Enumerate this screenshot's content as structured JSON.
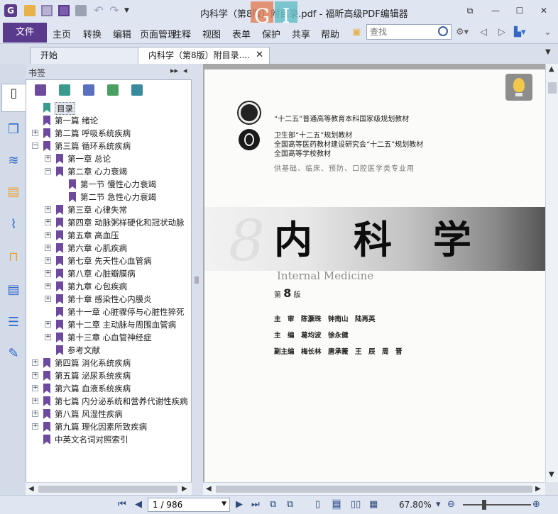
{
  "window": {
    "title": "内科学（第8版）附目录.pdf - 福昕高级PDF编辑器",
    "logo_letters": [
      "G",
      "I"
    ],
    "minimize": "—",
    "maximize": "☐",
    "close": "✕"
  },
  "ribbon": {
    "file": "文件",
    "menus": [
      "主页",
      "转换",
      "编辑",
      "页面管理",
      "注释",
      "视图",
      "表单",
      "保护",
      "共享",
      "帮助"
    ],
    "search_placeholder": "查找"
  },
  "tabs": [
    {
      "label": "开始"
    },
    {
      "label": "内科学（第8版）附目录....",
      "close": "✕"
    }
  ],
  "bookmarks": {
    "title": "书签",
    "items": [
      {
        "label": "目录",
        "level": 0,
        "expander": "",
        "selected": true,
        "icon": "teal-bookmark-icon"
      },
      {
        "label": "第一篇 绪论",
        "level": 0,
        "expander": ""
      },
      {
        "label": "第二篇 呼吸系统疾病",
        "level": 0,
        "expander": "+"
      },
      {
        "label": "第三篇 循环系统疾病",
        "level": 0,
        "expander": "−"
      },
      {
        "label": "第一章 总论",
        "level": 1,
        "expander": "+"
      },
      {
        "label": "第二章 心力衰竭",
        "level": 1,
        "expander": "−"
      },
      {
        "label": "第一节 慢性心力衰竭",
        "level": 2,
        "expander": ""
      },
      {
        "label": "第二节 急性心力衰竭",
        "level": 2,
        "expander": ""
      },
      {
        "label": "第三章 心律失常",
        "level": 1,
        "expander": "+"
      },
      {
        "label": "第四章 动脉粥样硬化和冠状动脉",
        "level": 1,
        "expander": "+"
      },
      {
        "label": "第五章 高血压",
        "level": 1,
        "expander": "+"
      },
      {
        "label": "第六章 心肌疾病",
        "level": 1,
        "expander": "+"
      },
      {
        "label": "第七章 先天性心血管病",
        "level": 1,
        "expander": "+"
      },
      {
        "label": "第八章 心脏瓣膜病",
        "level": 1,
        "expander": "+"
      },
      {
        "label": "第九章 心包疾病",
        "level": 1,
        "expander": "+"
      },
      {
        "label": "第十章 感染性心内膜炎",
        "level": 1,
        "expander": "+"
      },
      {
        "label": "第十一章 心脏骤停与心脏性猝死",
        "level": 1,
        "expander": ""
      },
      {
        "label": "第十二章 主动脉与周围血管病",
        "level": 1,
        "expander": "+"
      },
      {
        "label": "第十三章 心血管神经症",
        "level": 1,
        "expander": "+"
      },
      {
        "label": "参考文献",
        "level": 1,
        "expander": ""
      },
      {
        "label": "第四篇 消化系统疾病",
        "level": 0,
        "expander": "+"
      },
      {
        "label": "第五篇 泌尿系统疾病",
        "level": 0,
        "expander": "+"
      },
      {
        "label": "第六篇 血液系统疾病",
        "level": 0,
        "expander": "+"
      },
      {
        "label": "第七篇 内分泌系统和营养代谢性疾病",
        "level": 0,
        "expander": "+"
      },
      {
        "label": "第八篇 风湿性疾病",
        "level": 0,
        "expander": "+"
      },
      {
        "label": "第九篇 理化因素所致疾病",
        "level": 0,
        "expander": "+"
      },
      {
        "label": "中英文名词对照索引",
        "level": 0,
        "expander": ""
      }
    ]
  },
  "document": {
    "line1": "“十二五”普通高等教育本科国家级规划教材",
    "line2": "卫生部“十二五”规划教材",
    "line3": "全国高等医药教材建设研究会“十二五”规划教材",
    "line4": "全国高等学校教材",
    "line5": "供基础、临床、预防、口腔医学类专业用",
    "title": "内科学",
    "english_title": "Internal Medicine",
    "edition_prefix": "第",
    "edition_number": "8",
    "edition_suffix": "版",
    "chief_reviewers": "主　审　陈灏珠　钟南山　陆再英",
    "editors": "主　编　葛均波　徐永健",
    "associate_editors": "副主编　梅长林　唐承薇　王　辰　周　晋"
  },
  "status": {
    "page_value": "1 / 986",
    "zoom": "67.80%",
    "zoom_level_percent": 67.8
  },
  "colors": {
    "brand_purple": "#5a3a8c",
    "bookmark_purple": "#6e4a9e",
    "bookmark_teal": "#3a9a8e",
    "accent_blue": "#3468c8"
  }
}
